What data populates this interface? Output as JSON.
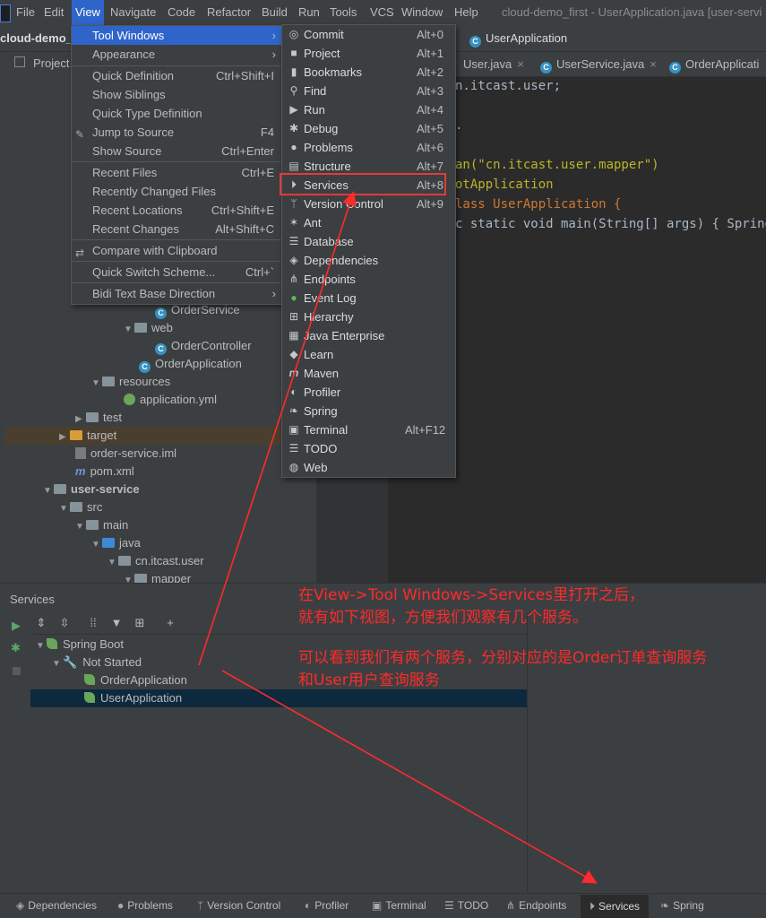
{
  "menubar": {
    "items": [
      "File",
      "Edit",
      "View",
      "Navigate",
      "Code",
      "Refactor",
      "Build",
      "Run",
      "Tools",
      "VCS",
      "Window",
      "Help"
    ],
    "title": "cloud-demo_first - UserApplication.java [user-servi"
  },
  "navbar": {
    "project": "cloud-demo_f",
    "file": "UserApplication"
  },
  "project_panel": {
    "header": "Project",
    "rows": [
      {
        "label": "OrderService",
        "type": "class"
      },
      {
        "label": "web",
        "type": "folder"
      },
      {
        "label": "OrderController",
        "type": "class"
      },
      {
        "label": "OrderApplication",
        "type": "class"
      },
      {
        "label": "resources",
        "type": "folder"
      },
      {
        "label": "application.yml",
        "type": "yml"
      },
      {
        "label": "test",
        "type": "folder"
      },
      {
        "label": "target",
        "type": "folder-orange"
      },
      {
        "label": "order-service.iml",
        "type": "iml"
      },
      {
        "label": "pom.xml",
        "type": "maven"
      },
      {
        "label": "user-service",
        "type": "module"
      },
      {
        "label": "src",
        "type": "folder"
      },
      {
        "label": "main",
        "type": "folder"
      },
      {
        "label": "java",
        "type": "folder-blue"
      },
      {
        "label": "cn.itcast.user",
        "type": "folder"
      },
      {
        "label": "mapper",
        "type": "folder"
      }
    ]
  },
  "editor": {
    "tabs": [
      "User.java",
      "UserService.java",
      "OrderApplicati"
    ],
    "lines": [
      "n.itcast.user;",
      ".",
      "an(\"cn.itcast.user.mapper\")",
      "otApplication",
      "lass UserApplication {",
      "c static void main(String[] args) { SpringA"
    ]
  },
  "view_menu": {
    "items": [
      {
        "label": "Tool Windows",
        "shortcut": "",
        "submenu": true,
        "selected": true
      },
      {
        "label": "Appearance",
        "shortcut": "",
        "submenu": true
      },
      {
        "label": "Quick Definition",
        "shortcut": "Ctrl+Shift+I"
      },
      {
        "label": "Show Siblings",
        "shortcut": ""
      },
      {
        "label": "Quick Type Definition",
        "shortcut": ""
      },
      {
        "label": "Jump to Source",
        "shortcut": "F4"
      },
      {
        "label": "Show Source",
        "shortcut": "Ctrl+Enter"
      },
      {
        "label": "Recent Files",
        "shortcut": "Ctrl+E"
      },
      {
        "label": "Recently Changed Files",
        "shortcut": ""
      },
      {
        "label": "Recent Locations",
        "shortcut": "Ctrl+Shift+E"
      },
      {
        "label": "Recent Changes",
        "shortcut": "Alt+Shift+C"
      },
      {
        "label": "Compare with Clipboard",
        "shortcut": ""
      },
      {
        "label": "Quick Switch Scheme...",
        "shortcut": "Ctrl+`"
      },
      {
        "label": "Bidi Text Base Direction",
        "shortcut": "",
        "submenu": true
      }
    ]
  },
  "tool_windows_menu": {
    "items": [
      {
        "label": "Commit",
        "shortcut": "Alt+0",
        "icon": "commit-icon"
      },
      {
        "label": "Project",
        "shortcut": "Alt+1",
        "icon": "project-icon"
      },
      {
        "label": "Bookmarks",
        "shortcut": "Alt+2",
        "icon": "bookmark-icon"
      },
      {
        "label": "Find",
        "shortcut": "Alt+3",
        "icon": "find-icon"
      },
      {
        "label": "Run",
        "shortcut": "Alt+4",
        "icon": "run-icon"
      },
      {
        "label": "Debug",
        "shortcut": "Alt+5",
        "icon": "debug-icon"
      },
      {
        "label": "Problems",
        "shortcut": "Alt+6",
        "icon": "problems-icon"
      },
      {
        "label": "Structure",
        "shortcut": "Alt+7",
        "icon": "structure-icon"
      },
      {
        "label": "Services",
        "shortcut": "Alt+8",
        "icon": "services-icon"
      },
      {
        "label": "Version Control",
        "shortcut": "Alt+9",
        "icon": "vcs-icon"
      },
      {
        "label": "Ant",
        "shortcut": "",
        "icon": "ant-icon"
      },
      {
        "label": "Database",
        "shortcut": "",
        "icon": "database-icon"
      },
      {
        "label": "Dependencies",
        "shortcut": "",
        "icon": "dependencies-icon"
      },
      {
        "label": "Endpoints",
        "shortcut": "",
        "icon": "endpoints-icon"
      },
      {
        "label": "Event Log",
        "shortcut": "",
        "icon": "event-log-icon"
      },
      {
        "label": "Hierarchy",
        "shortcut": "",
        "icon": "hierarchy-icon"
      },
      {
        "label": "Java Enterprise",
        "shortcut": "",
        "icon": "java-enterprise-icon"
      },
      {
        "label": "Learn",
        "shortcut": "",
        "icon": "learn-icon"
      },
      {
        "label": "Maven",
        "shortcut": "",
        "icon": "maven-icon"
      },
      {
        "label": "Profiler",
        "shortcut": "",
        "icon": "profiler-icon"
      },
      {
        "label": "Spring",
        "shortcut": "",
        "icon": "spring-icon"
      },
      {
        "label": "Terminal",
        "shortcut": "Alt+F12",
        "icon": "terminal-icon"
      },
      {
        "label": "TODO",
        "shortcut": "",
        "icon": "todo-icon"
      },
      {
        "label": "Web",
        "shortcut": "",
        "icon": "web-icon"
      }
    ]
  },
  "services": {
    "title": "Services",
    "tree": [
      {
        "label": "Spring Boot"
      },
      {
        "label": "Not Started"
      },
      {
        "label": "OrderApplication"
      },
      {
        "label": "UserApplication",
        "selected": true
      }
    ]
  },
  "annotation": {
    "line1": "在View->Tool Windows->Services里打开之后，",
    "line2": "就有如下视图，方便我们观察有几个服务。",
    "line3": "可以看到我们有两个服务，分别对应的是Order订单查询服务",
    "line4": "和User用户查询服务",
    "color": "#ff2a2a"
  },
  "statusbar": {
    "tabs": [
      "Dependencies",
      "Problems",
      "Version Control",
      "Profiler",
      "Terminal",
      "TODO",
      "Endpoints",
      "Services",
      "Spring"
    ],
    "active": "Services"
  }
}
